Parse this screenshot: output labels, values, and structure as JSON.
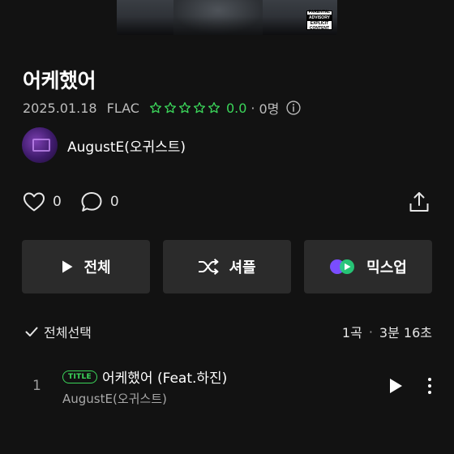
{
  "album": {
    "cover_advisory_top": "PARENTAL",
    "cover_advisory_mid": "ADVISORY",
    "cover_advisory_bottom": "EXPLICIT CONTENT",
    "title": "어케했어",
    "release_date": "2025.01.18",
    "format": "FLAC",
    "rating_value": "0.0",
    "rating_count": "0명",
    "stars_filled": 0,
    "stars_total": 5
  },
  "artist": {
    "name": "AugustE(오귀스트)"
  },
  "social": {
    "likes": "0",
    "comments": "0"
  },
  "actions": {
    "play_all": "전체",
    "shuffle": "셔플",
    "mix_up": "믹스업"
  },
  "list_header": {
    "select_all": "전체선택",
    "track_count": "1곡",
    "duration": "3분 16초"
  },
  "tracks": [
    {
      "index": "1",
      "badge": "TITLE",
      "title": "어케했어 (Feat.하진)",
      "artist": "AugustE(오귀스트)"
    }
  ],
  "colors": {
    "background": "#121212",
    "accent_green": "#3bd65a",
    "button_bg": "#2b2b2b"
  },
  "icons": [
    "info-icon",
    "heart-icon",
    "comment-icon",
    "share-icon",
    "play-icon",
    "shuffle-icon",
    "mixup-icon",
    "check-icon",
    "more-icon"
  ]
}
